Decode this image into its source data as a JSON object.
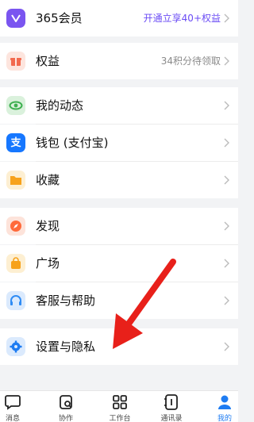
{
  "menu": {
    "vip": {
      "label": "365会员",
      "extra": "开通立享40+权益",
      "icon": "vip-crown-icon",
      "color": "#7a55f0"
    },
    "rights": {
      "label": "权益",
      "extra": "34积分待领取",
      "icon": "gift-icon",
      "color": "#f26a4f"
    },
    "moments": {
      "label": "我的动态",
      "icon": "eye-icon",
      "color": "#3db04f"
    },
    "wallet": {
      "label": "钱包 (支付宝)",
      "icon": "alipay-icon",
      "color": "#1677ff"
    },
    "favorites": {
      "label": "收藏",
      "icon": "folder-icon",
      "color": "#f7a21b"
    },
    "discover": {
      "label": "发现",
      "icon": "compass-icon",
      "color": "#ff6a3a"
    },
    "plaza": {
      "label": "广场",
      "icon": "shopping-bag-icon",
      "color": "#f7a21b"
    },
    "service": {
      "label": "客服与帮助",
      "icon": "headset-icon",
      "color": "#2f8cf5"
    },
    "settings": {
      "label": "设置与隐私",
      "icon": "gear-icon",
      "color": "#1e7cf2"
    }
  },
  "tabbar": {
    "items": [
      {
        "label": "消息",
        "icon": "message-icon"
      },
      {
        "label": "协作",
        "icon": "collaboration-icon"
      },
      {
        "label": "工作台",
        "icon": "workbench-grid-icon"
      },
      {
        "label": "通讯录",
        "icon": "contacts-book-icon"
      },
      {
        "label": "我的",
        "icon": "profile-icon",
        "active": true
      }
    ],
    "active_color": "#1e7cf2"
  },
  "annotation": {
    "arrow_color": "#e8201a",
    "icon": "red-arrow-icon"
  }
}
